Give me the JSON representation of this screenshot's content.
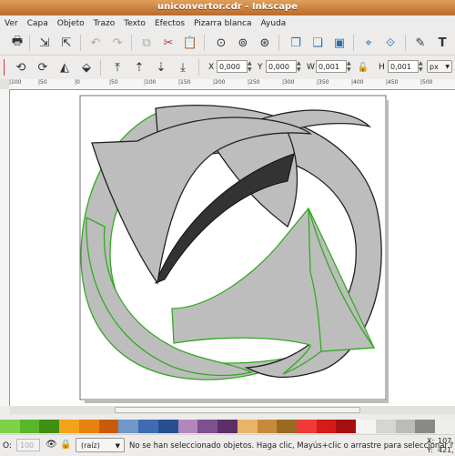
{
  "window": {
    "title": "uniconvertor.cdr - Inkscape"
  },
  "menu": [
    "Ver",
    "Capa",
    "Objeto",
    "Trazo",
    "Texto",
    "Efectos",
    "Pizarra blanca",
    "Ayuda"
  ],
  "toolbar2": {
    "x_label": "X",
    "x_value": "0,000",
    "y_label": "Y",
    "y_value": "0,000",
    "w_label": "W",
    "w_value": "0,001",
    "h_label": "H",
    "h_value": "0,001",
    "unit": "px"
  },
  "ruler": {
    "ticks": [
      "|100",
      "|50",
      "|0",
      "|50",
      "|100",
      "|150",
      "|200",
      "|250",
      "|300",
      "|350",
      "|400",
      "|450",
      "|500"
    ]
  },
  "colors": {
    "canvas_bg": "#ffffff",
    "shape_fill": "#bdbdbd",
    "shape_dark": "#333333",
    "green_outline": "#33aa22",
    "palette": [
      "#7fd147",
      "#57b62a",
      "#3f8f14",
      "#f5a21a",
      "#e8820e",
      "#c85a08",
      "#6f97c8",
      "#3f6cb0",
      "#264f8f",
      "#b287bb",
      "#7f4f8f",
      "#5a2f6a",
      "#e8b46a",
      "#c88a3a",
      "#9a6a20",
      "#ef3a3a",
      "#d41a1a",
      "#a50f0f",
      "#f4f4f2",
      "#d3d7cf",
      "#babdb6",
      "#888a85",
      "#eeeeec"
    ]
  },
  "status": {
    "opacity_label": "O:",
    "opacity_value": "100",
    "layer": "(raíz)",
    "message": "No se han seleccionado objetos. Haga clic, Mayús+clic o arrastre para seleccionar l",
    "x_label": "X:",
    "x_value": "107,",
    "y_label": "Y:",
    "y_value": "421,"
  }
}
